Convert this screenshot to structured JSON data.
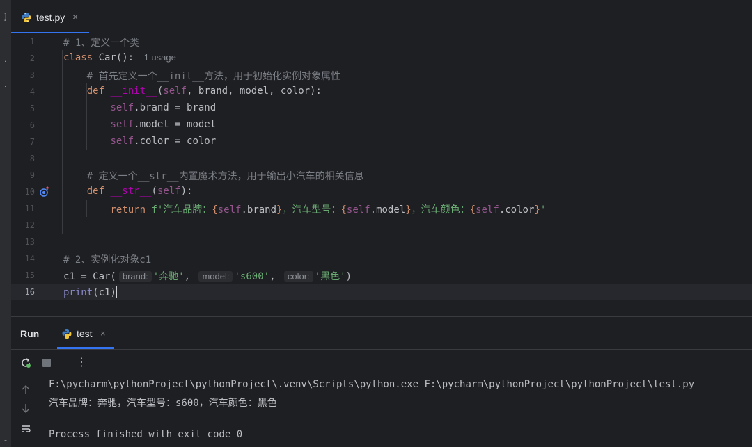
{
  "editor_tab": {
    "title": "test.py",
    "close_glyph": "×",
    "icon": "python-icon"
  },
  "code_lines": [
    {
      "num": "1",
      "text": "# 1、定义一个类"
    },
    {
      "num": "2",
      "text": "class Car():",
      "usage": "1 usage"
    },
    {
      "num": "3",
      "text": "    # 首先定义一个__init__方法，用于初始化实例对象属性"
    },
    {
      "num": "4",
      "text": "    def __init__(self, brand, model, color):"
    },
    {
      "num": "5",
      "text": "        self.brand = brand"
    },
    {
      "num": "6",
      "text": "        self.model = model"
    },
    {
      "num": "7",
      "text": "        self.color = color"
    },
    {
      "num": "8",
      "text": ""
    },
    {
      "num": "9",
      "text": "    # 定义一个__str__内置魔术方法，用于输出小汽车的相关信息"
    },
    {
      "num": "10",
      "text": "    def __str__(self):"
    },
    {
      "num": "11",
      "text": "        return f'汽车品牌：{self.brand}，汽车型号：{self.model}，汽车颜色：{self.color}'"
    },
    {
      "num": "12",
      "text": ""
    },
    {
      "num": "13",
      "text": ""
    },
    {
      "num": "14",
      "text": "# 2、实例化对象c1"
    },
    {
      "num": "15",
      "text": "c1 = Car('奔驰', 's600', '黑色')"
    },
    {
      "num": "16",
      "text": "print(c1)"
    }
  ],
  "inlay_hints": {
    "brand": "brand:",
    "model": "model:",
    "color": "color:"
  },
  "run_panel": {
    "title": "Run",
    "tab_label": "test",
    "close_glyph": "×",
    "more_glyph": "⋮",
    "console": [
      "F:\\pycharm\\pythonProject\\pythonProject\\.venv\\Scripts\\python.exe F:\\pycharm\\pythonProject\\pythonProject\\test.py",
      "汽车品牌：奔驰，汽车型号：s600，汽车颜色：黑色",
      "",
      "Process finished with exit code 0"
    ]
  },
  "colors": {
    "background": "#1e1f22",
    "keyword": "#cf8e6d",
    "magic_method": "#b200b2",
    "self": "#94558d",
    "comment": "#7a7e85",
    "string": "#6aab73",
    "accent": "#3574f0"
  },
  "icons": [
    "python-icon",
    "override-icon",
    "rerun-icon",
    "stop-icon",
    "more-icon",
    "up-arrow-icon",
    "down-arrow-icon",
    "soft-wrap-icon"
  ]
}
